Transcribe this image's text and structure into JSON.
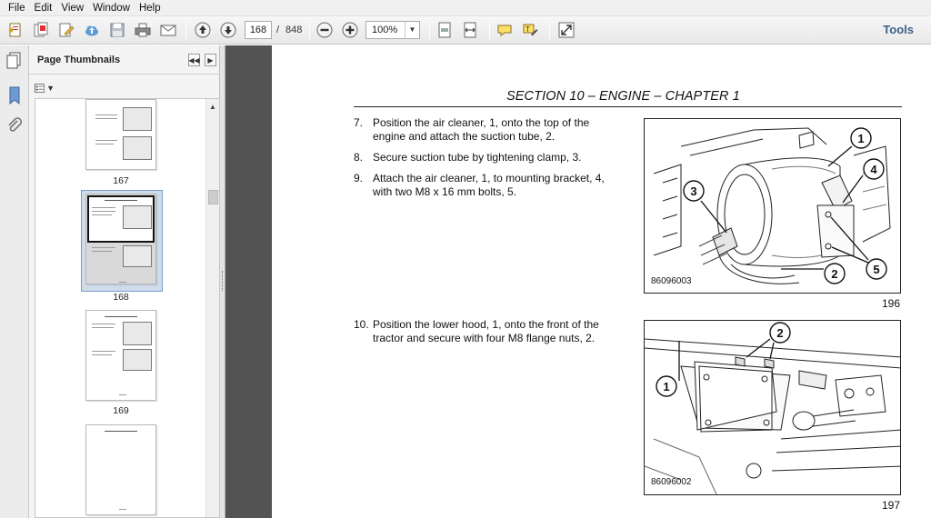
{
  "menu": [
    "File",
    "Edit",
    "View",
    "Window",
    "Help"
  ],
  "toolbar": {
    "current_page": "168",
    "page_separator": "/",
    "total_pages": "848",
    "zoom": "100%",
    "tools_label": "Tools"
  },
  "thumbnails": {
    "title": "Page Thumbnails",
    "pages": [
      {
        "label": "167"
      },
      {
        "label": "168"
      },
      {
        "label": "169"
      },
      {
        "label": ""
      }
    ]
  },
  "document": {
    "section_title": "SECTION 10 – ENGINE – CHAPTER 1",
    "block1": {
      "steps": [
        {
          "num": "7.",
          "text": "Position the air cleaner, 1, onto the top of the engine and attach the suction tube, 2."
        },
        {
          "num": "8.",
          "text": "Secure suction tube by tightening clamp, 3."
        },
        {
          "num": "9.",
          "text": "Attach the air cleaner, 1, to mounting bracket, 4, with two M8 x 16 mm bolts, 5."
        }
      ],
      "figure_code": "86096003",
      "figure_page": "196",
      "callouts": [
        "1",
        "2",
        "3",
        "4",
        "5"
      ]
    },
    "block2": {
      "steps": [
        {
          "num": "10.",
          "text": "Position the lower hood, 1, onto the front of the tractor and secure with four M8 flange nuts, 2."
        }
      ],
      "figure_code": "86096002",
      "figure_page": "197",
      "callouts": [
        "1",
        "2"
      ]
    }
  }
}
